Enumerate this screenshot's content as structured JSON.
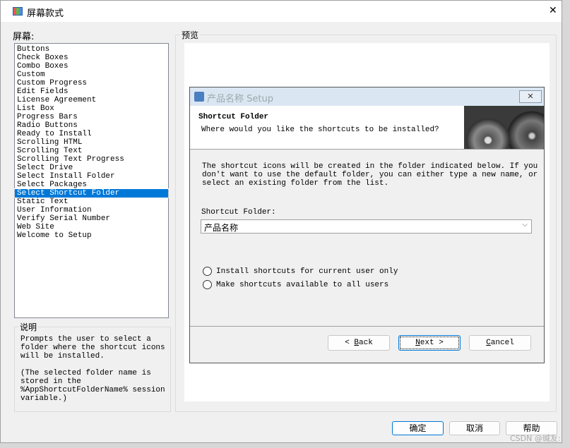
{
  "window": {
    "title": "屏幕款式",
    "close": "✕"
  },
  "screens": {
    "label": "屏幕:",
    "items": [
      "Buttons",
      "Check Boxes",
      "Combo Boxes",
      "Custom",
      "Custom Progress",
      "Edit Fields",
      "License Agreement",
      "List Box",
      "Progress Bars",
      "Radio Buttons",
      "Ready to Install",
      "Scrolling HTML",
      "Scrolling Text",
      "Scrolling Text Progress",
      "Select Drive",
      "Select Install Folder",
      "Select Packages",
      "Select Shortcut Folder",
      "Static Text",
      "User Information",
      "Verify Serial Number",
      "Web Site",
      "Welcome to Setup"
    ],
    "selected": "Select Shortcut Folder"
  },
  "description": {
    "label": "说明",
    "text": "Prompts the user to select a\nfolder where the shortcut icons\nwill be installed.\n\n(The selected folder name is\nstored in the\n%AppShortcutFolderName% session\nvariable.)"
  },
  "preview": {
    "label": "预览",
    "dialog": {
      "title": "产品名称 Setup",
      "close": "✕",
      "heading": "Shortcut Folder",
      "subheading": "Where would you like the shortcuts to be installed?",
      "body": "The shortcut icons will be created in the folder indicated below. If you\ndon't want to use the default folder, you can either type a new name, or\nselect an existing folder from the list.",
      "folder_label": "Shortcut Folder:",
      "folder_value": "产品名称",
      "radio_current": "Install shortcuts for current user only",
      "radio_all": "Make shortcuts available to all users",
      "back_key": "B",
      "back_rest": "ack",
      "next_key": "N",
      "next_rest": "ext >",
      "cancel_key": "C",
      "cancel_rest": "ancel",
      "back_prefix": "< "
    }
  },
  "buttons": {
    "ok": "确定",
    "cancel": "取消",
    "help": "帮助"
  },
  "watermark": "CSDN @缄友:"
}
